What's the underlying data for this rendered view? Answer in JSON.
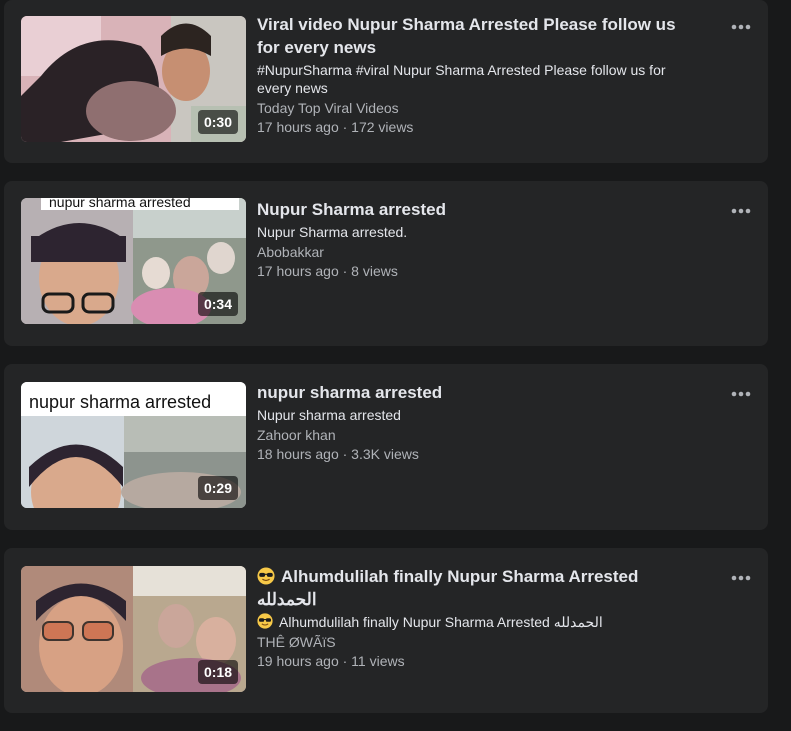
{
  "videos": [
    {
      "title": "Viral video Nupur Sharma Arrested Please follow us for every news",
      "description": "#NupurSharma #viral Nupur Sharma Arrested Please follow us for every news",
      "channel": "Today Top Viral Videos",
      "meta": "17 hours ago · 172 views",
      "duration": "0:30",
      "more_icon": "more-horizontal-icon"
    },
    {
      "title": "Nupur Sharma arrested",
      "description": "Nupur Sharma arrested.",
      "channel": "Abobakkar",
      "meta": "17 hours ago · 8 views",
      "duration": "0:34",
      "thumb_caption": "nupur sharma arrested",
      "more_icon": "more-horizontal-icon"
    },
    {
      "title": "nupur sharma arrested",
      "description": "Nupur sharma arrested",
      "channel": "Zahoor khan",
      "meta": "18 hours ago · 3.3K views",
      "duration": "0:29",
      "thumb_caption": "nupur sharma arrested",
      "more_icon": "more-horizontal-icon"
    },
    {
      "title": "Alhumdulilah finally Nupur Sharma Arrested الحمدلله",
      "description": "Alhumdulilah finally Nupur Sharma Arrested الحمدلله",
      "channel": "THÊ ØWÃïS",
      "meta": "19 hours ago · 11 views",
      "duration": "0:18",
      "title_icon": "sunglasses-emoji-icon",
      "more_icon": "more-horizontal-icon"
    }
  ],
  "colors": {
    "page_bg": "#18191a",
    "card_bg": "#242526",
    "primary_text": "#e4e6eb",
    "secondary_text": "#b0b3b8"
  }
}
